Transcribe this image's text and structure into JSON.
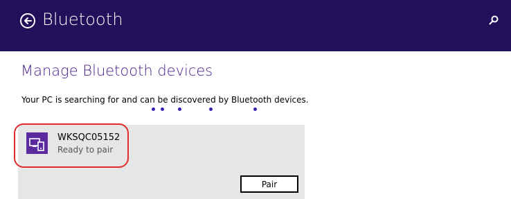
{
  "header": {
    "title": "Bluetooth",
    "back_icon": "back-arrow-circle-icon",
    "search_icon": "search-icon",
    "background": "#21115a"
  },
  "main": {
    "title": "Manage Bluetooth devices",
    "status_text": "Your PC is searching for and can be discovered by Bluetooth devices.",
    "title_color": "#4a1f8c",
    "progress_color": "#3d1fb0"
  },
  "devices": [
    {
      "name": "WKSQC05152",
      "status": "Ready to pair",
      "icon": "pc-phone-device-icon",
      "tile_color": "#5b2a9e",
      "action_label": "Pair",
      "highlighted": true
    }
  ],
  "colors": {
    "panel": "#e6e6e6",
    "highlight": "#e02b2b"
  }
}
